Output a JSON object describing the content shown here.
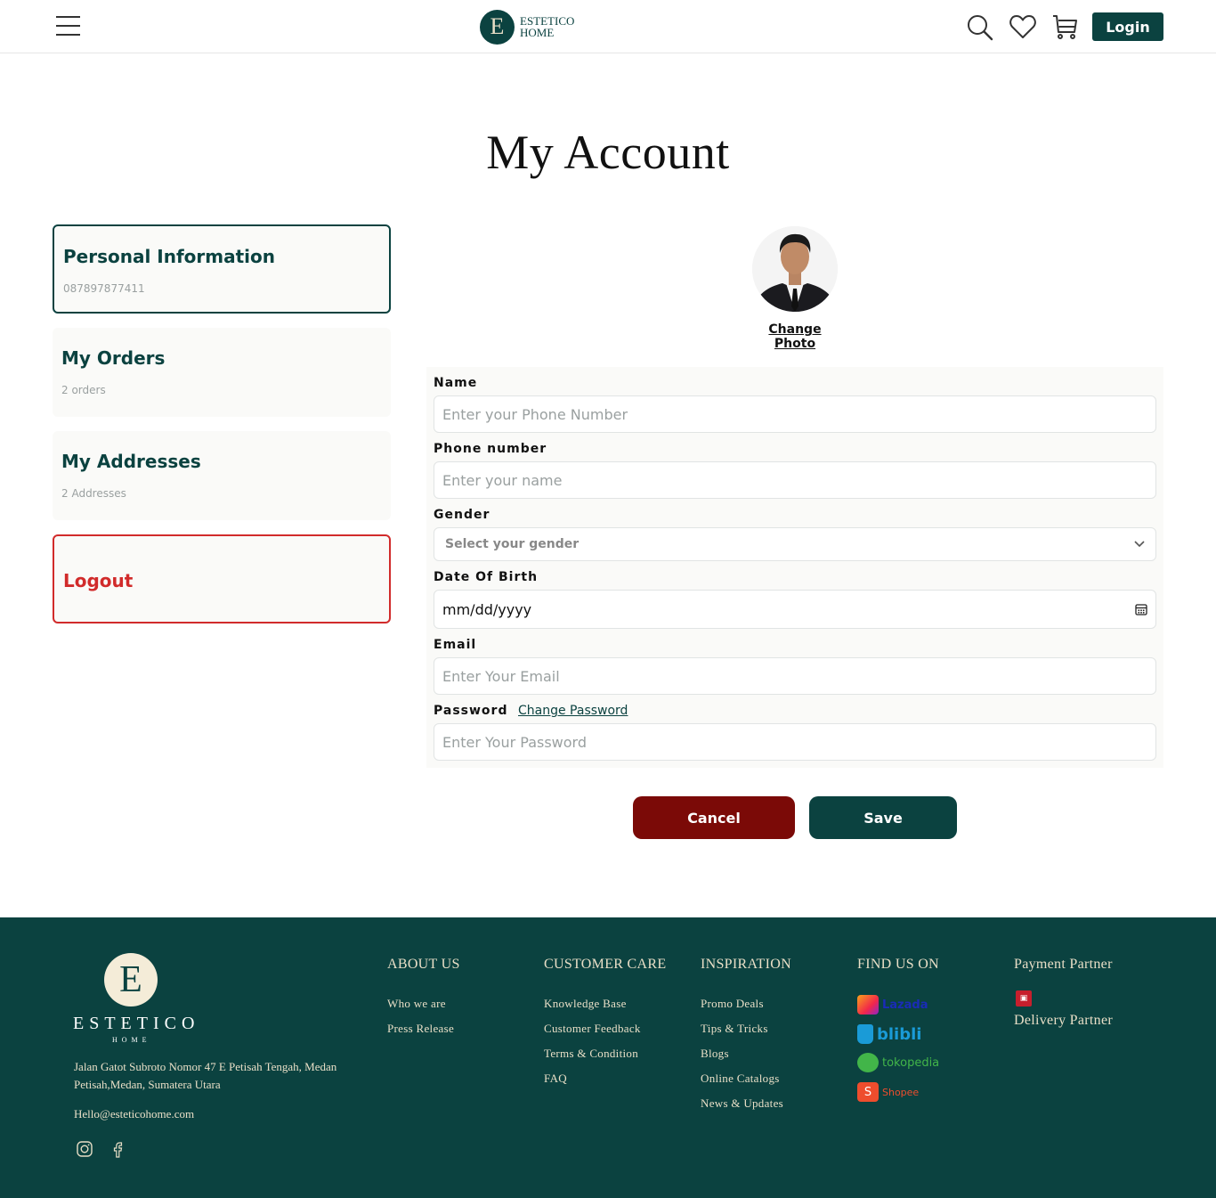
{
  "header": {
    "logo_letter": "E",
    "logo_line1": "ESTETICO",
    "logo_line2": "HOME",
    "login_label": "Login"
  },
  "page": {
    "title": "My Account"
  },
  "sidebar": {
    "items": [
      {
        "title": "Personal Information",
        "subtitle": "087897877411"
      },
      {
        "title": "My Orders",
        "subtitle": "2 orders"
      },
      {
        "title": "My Addresses",
        "subtitle": "2 Addresses"
      },
      {
        "title": "Logout",
        "subtitle": ""
      }
    ]
  },
  "profile": {
    "change_photo_label": "Change Photo"
  },
  "form": {
    "name": {
      "label": "Name",
      "placeholder": "Enter your Phone Number"
    },
    "phone": {
      "label": "Phone number",
      "placeholder": "Enter your name"
    },
    "gender": {
      "label": "Gender",
      "selected": "Select your gender"
    },
    "dob": {
      "label": "Date Of Birth",
      "value": "mm/dd/yyyy"
    },
    "email": {
      "label": "Email",
      "placeholder": "Enter Your Email"
    },
    "password": {
      "label": "Password",
      "change_label": "Change Password",
      "placeholder": "Enter Your Password"
    },
    "cancel_label": "Cancel",
    "save_label": "Save"
  },
  "footer": {
    "logo_letter": "E",
    "brand": "ESTETICO",
    "brand_sub": "HOME",
    "address": "Jalan Gatot Subroto Nomor 47 E Petisah Tengah, Medan Petisah,Medan, Sumatera Utara",
    "email": "Hello@esteticohome.com",
    "about": {
      "title": "ABOUT US",
      "links": [
        "Who we are",
        "Press Release"
      ]
    },
    "care": {
      "title": "CUSTOMER CARE",
      "links": [
        "Knowledge Base",
        "Customer Feedback",
        "Terms & Condition",
        "FAQ"
      ]
    },
    "inspiration": {
      "title": "INSPIRATION",
      "links": [
        "Promo Deals",
        "Tips & Tricks",
        "Blogs",
        "Online Catalogs",
        "News & Updates"
      ]
    },
    "find": {
      "title": "FIND US ON",
      "marketplaces": [
        "Lazada",
        "blibli",
        "tokopedia",
        "Shopee"
      ]
    },
    "payment": {
      "title": "Payment Partner",
      "delivery_title": "Delivery Partner"
    }
  },
  "colors": {
    "brand": "#0b4240",
    "danger": "#d12b2b",
    "cancel": "#7b0a07",
    "cream": "#e9dfc7"
  }
}
